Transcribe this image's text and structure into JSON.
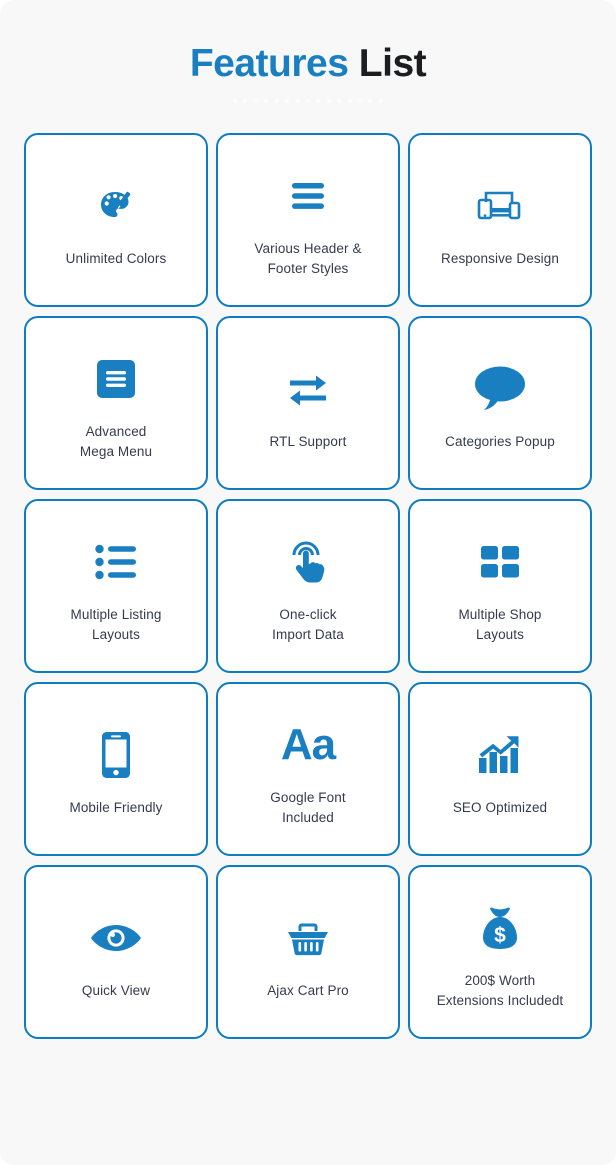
{
  "header": {
    "title_accent": "Features",
    "title_plain": "List",
    "divider_dot_count": 15
  },
  "theme": {
    "accent": "#1a7fc1",
    "border": "#0d7cc0",
    "card_bg": "#ffffff",
    "page_bg": "#f8f8f8",
    "label_color": "#343c4c"
  },
  "features": [
    {
      "icon": "color-palette-icon",
      "label": "Unlimited Colors"
    },
    {
      "icon": "hamburger-menu-icon",
      "label": "Various Header &\nFooter Styles"
    },
    {
      "icon": "responsive-devices-icon",
      "label": "Responsive Design"
    },
    {
      "icon": "mega-menu-icon",
      "label": "Advanced\nMega Menu"
    },
    {
      "icon": "exchange-arrows-icon",
      "label": "RTL Support"
    },
    {
      "icon": "speech-bubble-icon",
      "label": "Categories Popup"
    },
    {
      "icon": "bullet-list-icon",
      "label": "Multiple Listing\nLayouts"
    },
    {
      "icon": "tap-hand-icon",
      "label": "One-click\nImport Data"
    },
    {
      "icon": "grid-squares-icon",
      "label": "Multiple Shop\nLayouts"
    },
    {
      "icon": "mobile-phone-icon",
      "label": "Mobile Friendly"
    },
    {
      "icon": "typography-aa-icon",
      "label": "Google Font\nIncluded"
    },
    {
      "icon": "growth-chart-icon",
      "label": "SEO Optimized"
    },
    {
      "icon": "eye-icon",
      "label": "Quick View"
    },
    {
      "icon": "shopping-basket-icon",
      "label": "Ajax Cart Pro"
    },
    {
      "icon": "money-bag-icon",
      "label": "200$ Worth\nExtensions Includedt"
    }
  ]
}
